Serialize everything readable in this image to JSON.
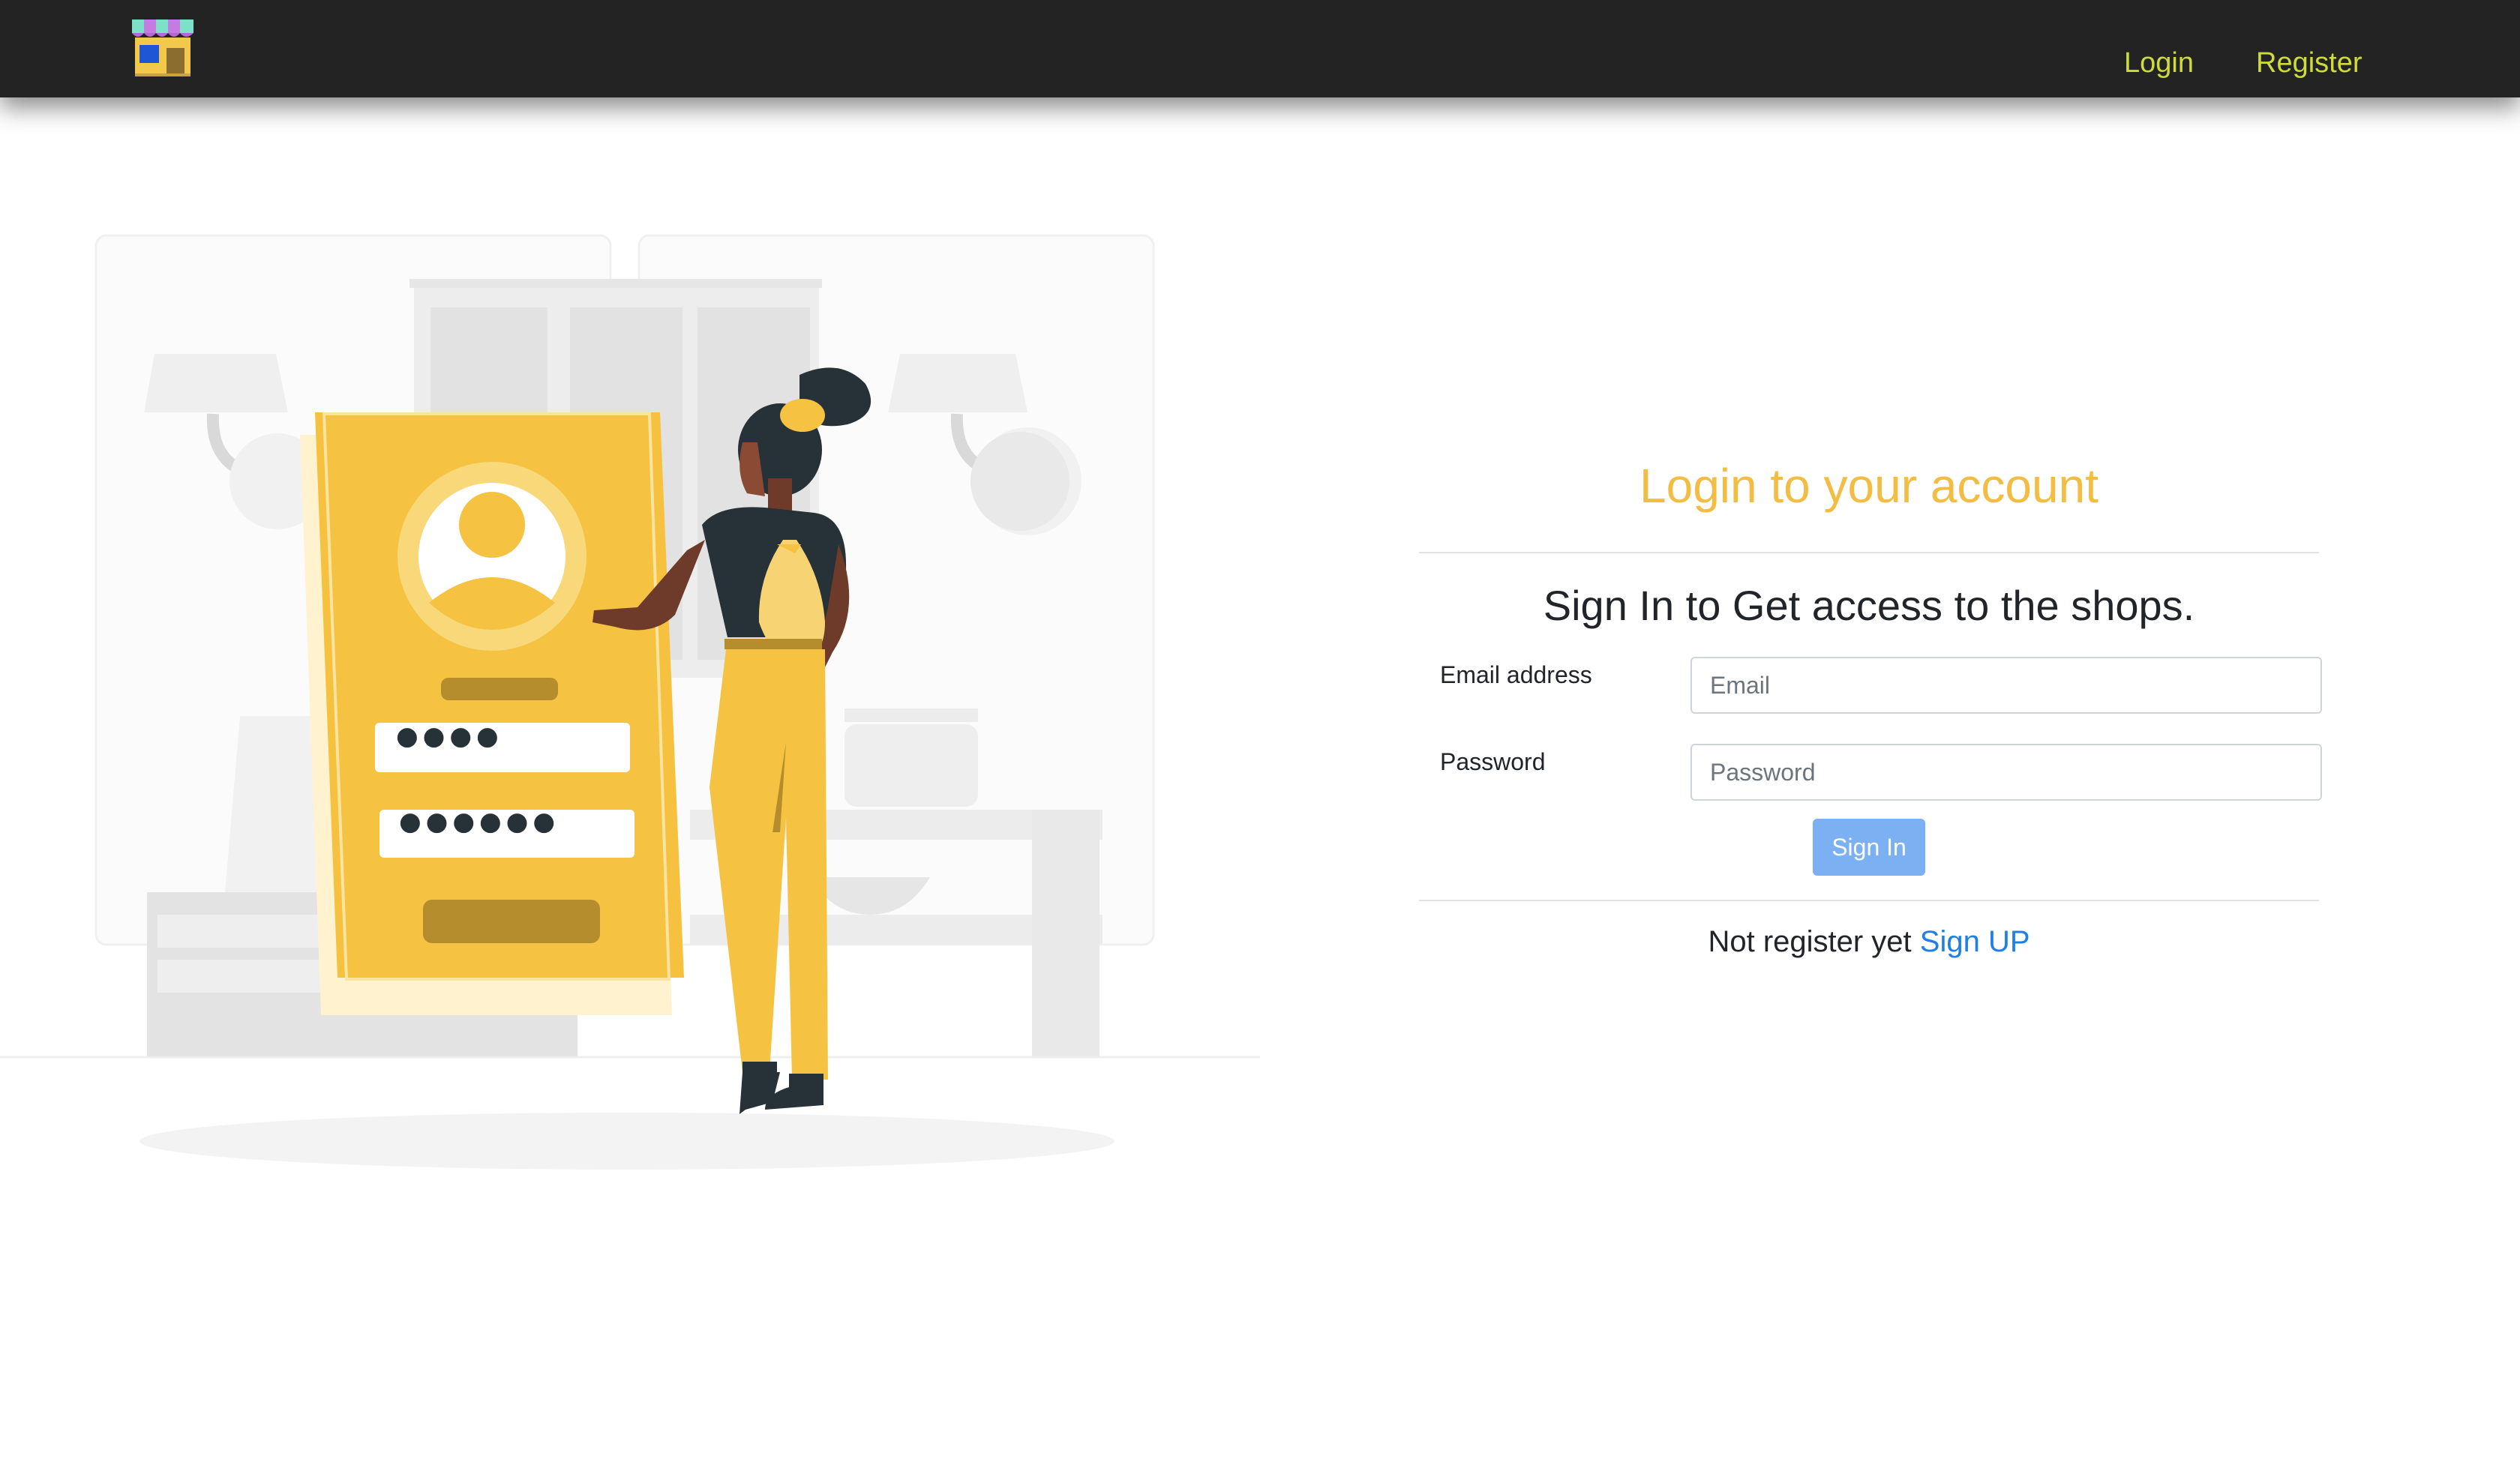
{
  "navbar": {
    "logo_icon": "shop-store-icon",
    "links": [
      {
        "label": "Login"
      },
      {
        "label": "Register"
      }
    ],
    "link_color": "#cddc39",
    "background": "#232323"
  },
  "illustration": {
    "icon": "woman-with-phone-login-illustration",
    "password_dots": [
      "●●●●",
      "●●●●●●"
    ]
  },
  "login_form": {
    "title": "Login to your account",
    "subtitle": "Sign In to Get access to the shops.",
    "email": {
      "label": "Email address",
      "placeholder": "Email",
      "value": ""
    },
    "password": {
      "label": "Password",
      "placeholder": "Password",
      "value": ""
    },
    "submit_label": "Sign In",
    "register_prompt": "Not register yet",
    "register_link": "Sign UP",
    "colors": {
      "title": "#f2bd42",
      "button": "#7bb1f3",
      "link": "#1e7fe5"
    }
  }
}
